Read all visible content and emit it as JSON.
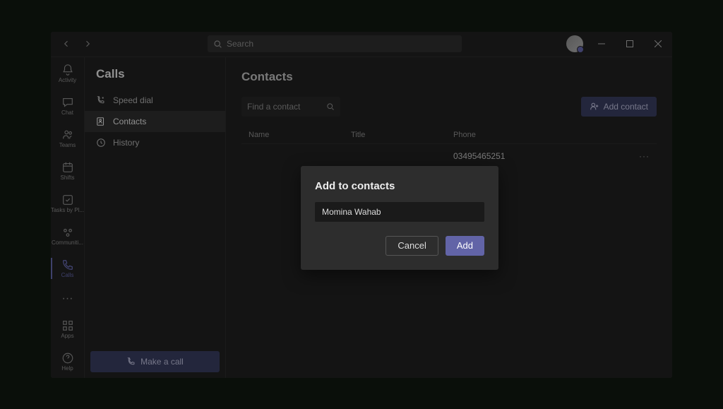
{
  "titlebar": {
    "search_placeholder": "Search"
  },
  "apprail": {
    "items": [
      {
        "label": "Activity"
      },
      {
        "label": "Chat"
      },
      {
        "label": "Teams"
      },
      {
        "label": "Shifts"
      },
      {
        "label": "Tasks by Pl..."
      },
      {
        "label": "Communiti..."
      },
      {
        "label": "Calls"
      }
    ],
    "apps_label": "Apps",
    "help_label": "Help"
  },
  "secondary": {
    "title": "Calls",
    "items": [
      {
        "label": "Speed dial"
      },
      {
        "label": "Contacts"
      },
      {
        "label": "History"
      }
    ],
    "make_call": "Make a call"
  },
  "content": {
    "title": "Contacts",
    "find_placeholder": "Find a contact",
    "add_contact_label": "Add contact",
    "columns": {
      "name": "Name",
      "title": "Title",
      "phone": "Phone"
    },
    "rows": [
      {
        "name": "",
        "title": "",
        "phone": "03495465251"
      }
    ]
  },
  "modal": {
    "title": "Add to contacts",
    "input_value": "Momina Wahab",
    "cancel": "Cancel",
    "add": "Add"
  }
}
